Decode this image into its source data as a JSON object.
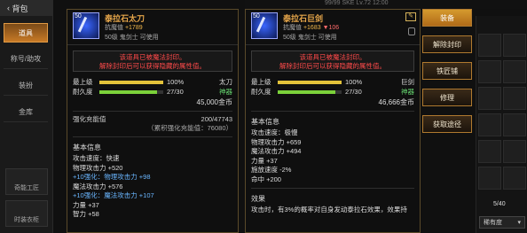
{
  "header": {
    "back_label": "背包",
    "status_text": "99/99 SKE Lv.72 12:00"
  },
  "rail": {
    "tabs": [
      {
        "label": "道具"
      },
      {
        "label": "称号/助攻"
      },
      {
        "label": "装扮"
      },
      {
        "label": "金库"
      }
    ],
    "bottom": [
      {
        "label": "奇能工匠"
      },
      {
        "label": "时装衣柜"
      }
    ]
  },
  "left_item": {
    "level": "50",
    "name": "泰拉石太刀",
    "resist_label": "抗魔值",
    "resist_value": "+1789",
    "requirement": "50级 鬼剑士 可使用",
    "seal_text_line1": "该道具已被魔法封印。",
    "seal_text_line2": "解除封印后可以获得隐藏的属性值。",
    "grade_label": "最上级",
    "grade_percent": "100%",
    "grade_type": "太刀",
    "durability_label": "耐久度",
    "durability_value": "27/30",
    "durability_note": "神器",
    "price": "45,000金币",
    "reinforce_label": "强化充能值",
    "reinforce_value": "200/47743",
    "reinforce_total": "（累积强化充能值：76080）",
    "basic_info_title": "基本信息",
    "attack_speed": "攻击速度：快速",
    "stats": [
      {
        "text": "物理攻击力 +520",
        "blue": false
      },
      {
        "text": "+10强化：物理攻击力 +98",
        "blue": true
      },
      {
        "text": "魔法攻击力 +576",
        "blue": false
      },
      {
        "text": "+10强化：魔法攻击力 +107",
        "blue": true
      },
      {
        "text": "力量 +37",
        "blue": false
      },
      {
        "text": "智力 +58",
        "blue": false
      }
    ]
  },
  "right_item": {
    "level": "50",
    "name": "泰拉石巨剑",
    "resist_label": "抗魔值",
    "resist_value": "+1683",
    "resist_diff": "▼106",
    "requirement": "50级 鬼剑士 可使用",
    "seal_text_line1": "该道具已被魔法封印。",
    "seal_text_line2": "解除封印后可以获得隐藏的属性值。",
    "grade_label": "最上级",
    "grade_percent": "100%",
    "grade_type": "巨剑",
    "durability_label": "耐久度",
    "durability_value": "27/30",
    "durability_note": "神器",
    "price": "46,666金币",
    "basic_info_title": "基本信息",
    "stats": [
      "攻击速度：极慢",
      "物理攻击力 +659",
      "魔法攻击力 +494",
      "力量 +37",
      "施放速度 -2%",
      "命中 +200"
    ],
    "effect_title": "效果",
    "effect_text": "攻击时，有3%的概率对自身发动泰拉石效果，效果持"
  },
  "actions": [
    {
      "label": "装备",
      "primary": true
    },
    {
      "label": "解除封印",
      "primary": false
    },
    {
      "label": "铁匠铺",
      "primary": false
    },
    {
      "label": "修理",
      "primary": false
    },
    {
      "label": "获取途径",
      "primary": false
    }
  ],
  "inventory": {
    "count": "5/40",
    "sort_label": "稀有度"
  },
  "colors": {
    "gold": "#e6a64a",
    "seal_red": "#ff4a4a",
    "stat_blue": "#6ab6ff",
    "bar_yellow": "#e3c23a",
    "bar_green": "#7bd13a"
  },
  "bars": {
    "grade_fraction": 1.0,
    "durability_fraction": 0.9
  }
}
